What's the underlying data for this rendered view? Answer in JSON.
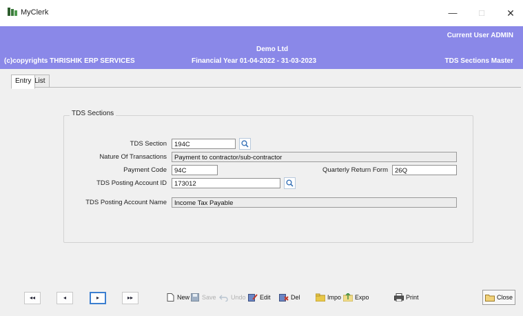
{
  "window": {
    "title": "MyClerk",
    "min_icon": "minimize-icon",
    "max_icon": "maximize-icon",
    "close_icon": "close-icon"
  },
  "header": {
    "current_user": "Current User ADMIN",
    "company": "Demo Ltd",
    "copyright": "(c)copyrights THRISHIK ERP SERVICES",
    "financial_year": "Financial Year 01-04-2022 - 31-03-2023",
    "module": "TDS Sections Master",
    "background": "#8a88e8"
  },
  "tabs": [
    {
      "label": "Entry",
      "active": true
    },
    {
      "label": "List",
      "active": false
    }
  ],
  "form": {
    "group_title": "TDS Sections",
    "tds_section": {
      "label": "TDS Section",
      "value": "194C"
    },
    "nature": {
      "label": "Nature Of Transactions",
      "value": "Payment to contractor/sub-contractor"
    },
    "payment_code": {
      "label": "Payment Code",
      "value": "94C"
    },
    "quarterly_form": {
      "label": "Quarterly Return Form",
      "value": "26Q"
    },
    "posting_id": {
      "label": "TDS Posting Account ID",
      "value": "173012"
    },
    "posting_name": {
      "label": "TDS Posting Account Name",
      "value": "Income Tax Payable"
    }
  },
  "navigation": {
    "first": "◂◂",
    "prev": "◂",
    "next": "▸",
    "last": "▸▸"
  },
  "toolbar": {
    "new": "New",
    "save": "Save",
    "undo": "Undo",
    "edit": "Edit",
    "delete": "Del",
    "import": "Impo",
    "export": "Expo",
    "print": "Print",
    "close": "Close"
  }
}
